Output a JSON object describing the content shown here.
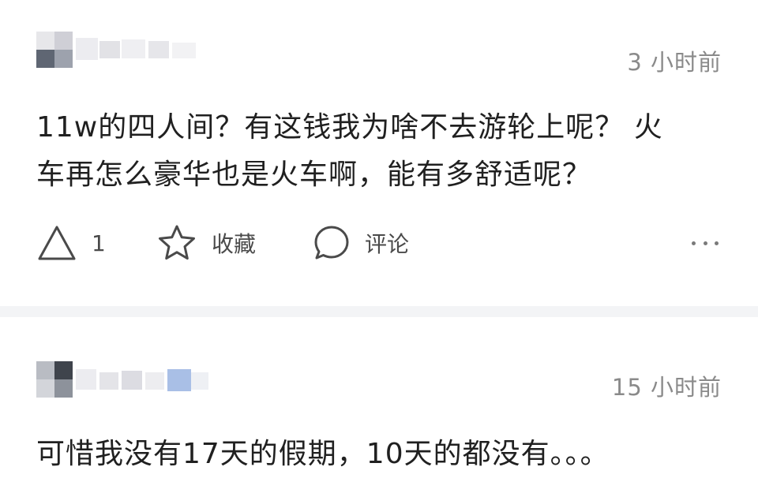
{
  "comments": [
    {
      "time": "3 小时前",
      "text_line1": "11w的四人间？有这钱我为啥不去游轮上呢？ 火",
      "text_line2": "车再怎么豪华也是火车啊，能有多舒适呢？",
      "likes": "1",
      "favorite_label": "收藏",
      "comment_label": "评论"
    },
    {
      "time": "15 小时前",
      "text_line1": "可惜我没有17天的假期，10天的都没有。。。"
    }
  ],
  "icons": [
    "like-triangle-icon",
    "star-icon",
    "comment-bubble-icon",
    "more-icon"
  ]
}
